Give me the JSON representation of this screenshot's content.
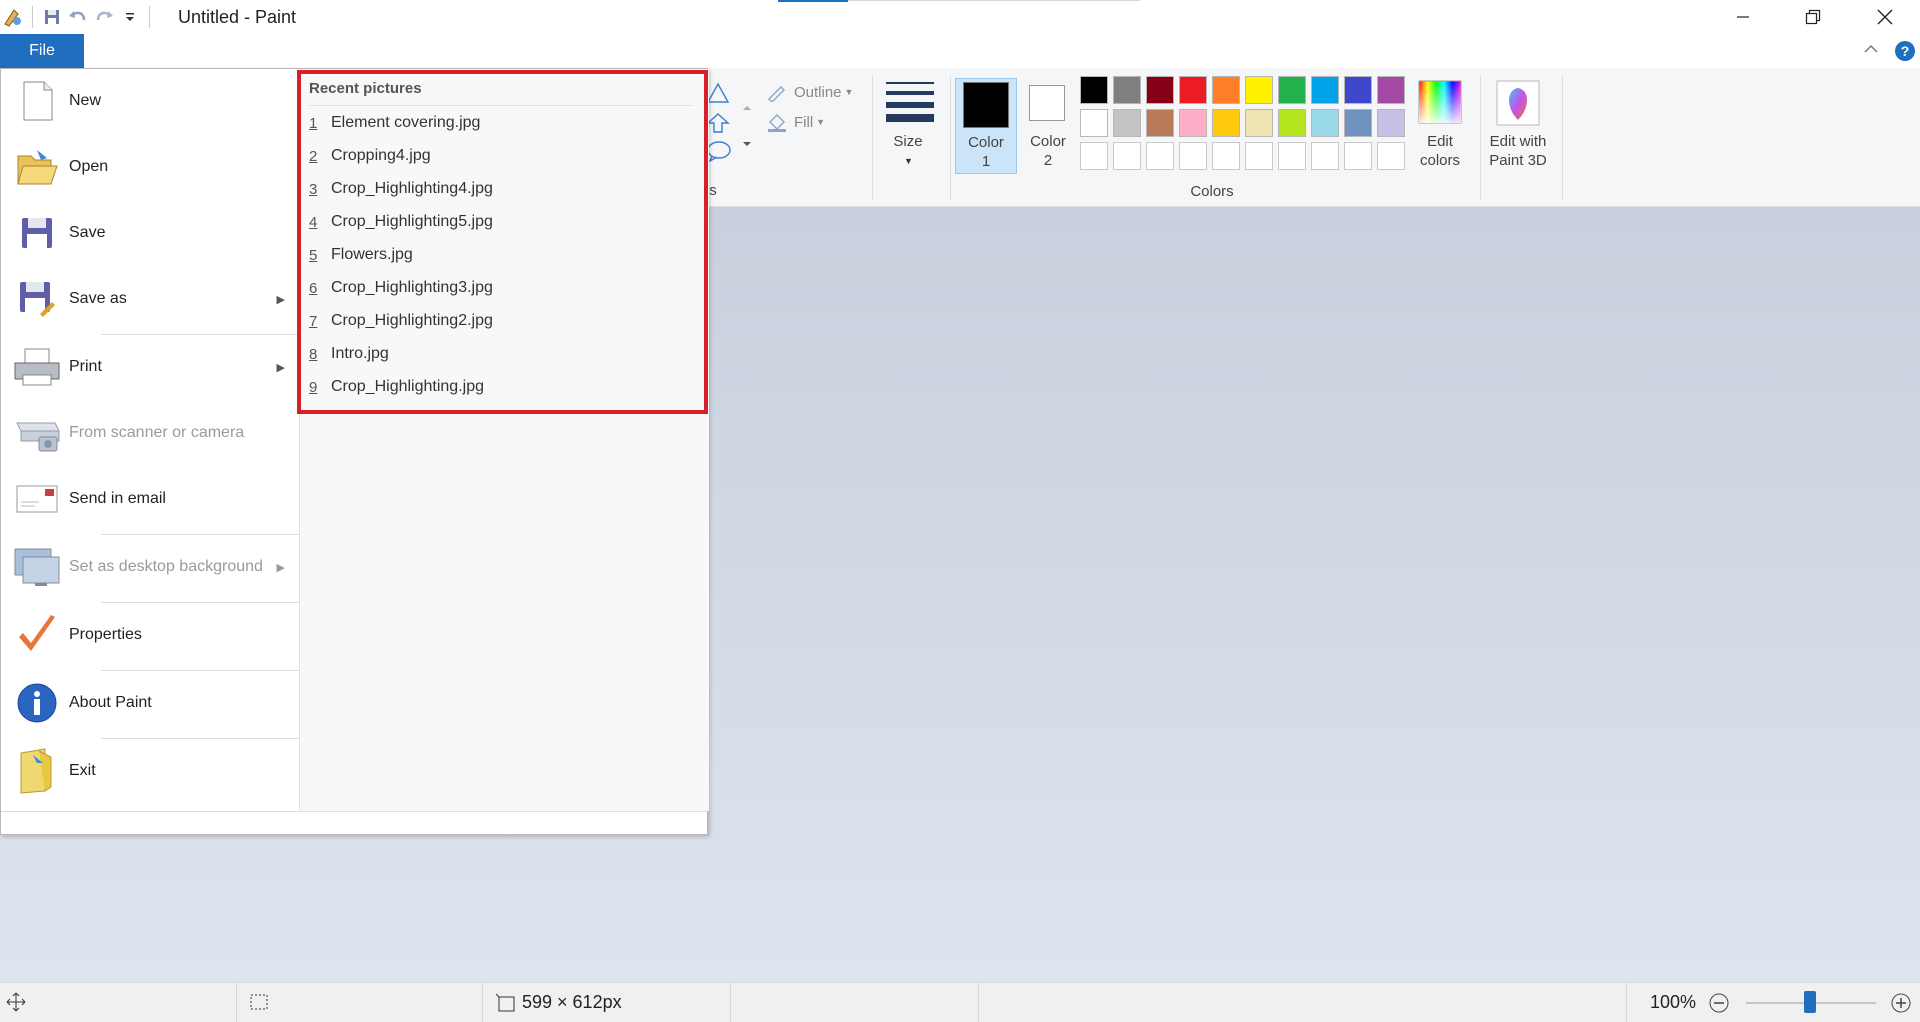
{
  "window": {
    "title": "Untitled - Paint"
  },
  "tabs": {
    "file_label": "File"
  },
  "ribbon": {
    "outline_label": "Outline",
    "fill_label": "Fill",
    "size_label": "Size",
    "color1_line1": "Color",
    "color1_line2": "1",
    "color2_line1": "Color",
    "color2_line2": "2",
    "edit_colors_line1": "Edit",
    "edit_colors_line2": "colors",
    "paint3d_line1": "Edit with",
    "paint3d_line2": "Paint 3D",
    "colors_group_label": "Colors",
    "shapes_group_fragment": "s",
    "palette_row1": [
      "#000000",
      "#7f7f7f",
      "#880015",
      "#ed1c24",
      "#ff7f27",
      "#fff200",
      "#22b14c",
      "#00a2e8",
      "#3f48cc",
      "#a349a4"
    ],
    "palette_row2": [
      "#ffffff",
      "#c3c3c3",
      "#b97a57",
      "#ffaec9",
      "#ffc90e",
      "#efe4b0",
      "#b5e61d",
      "#99d9ea",
      "#7092be",
      "#c8bfe7"
    ]
  },
  "file_menu": {
    "items": [
      {
        "label": "New",
        "icon": "new-document-icon"
      },
      {
        "label": "Open",
        "icon": "open-folder-icon"
      },
      {
        "label": "Save",
        "icon": "save-icon"
      },
      {
        "label": "Save as",
        "icon": "save-as-icon"
      },
      {
        "label": "Print",
        "icon": "printer-icon"
      },
      {
        "label": "From scanner or camera",
        "icon": "scanner-icon"
      },
      {
        "label": "Send in email",
        "icon": "email-icon"
      },
      {
        "label": "Set as desktop background",
        "icon": "desktop-icon"
      },
      {
        "label": "Properties",
        "icon": "checkmark-icon"
      },
      {
        "label": "About Paint",
        "icon": "info-icon"
      },
      {
        "label": "Exit",
        "icon": "exit-icon"
      }
    ],
    "recent_title": "Recent pictures",
    "recent": [
      {
        "num": "1",
        "name": "Element covering.jpg"
      },
      {
        "num": "2",
        "name": "Cropping4.jpg"
      },
      {
        "num": "3",
        "name": "Crop_Highlighting4.jpg"
      },
      {
        "num": "4",
        "name": "Crop_Highlighting5.jpg"
      },
      {
        "num": "5",
        "name": "Flowers.jpg"
      },
      {
        "num": "6",
        "name": "Crop_Highlighting3.jpg"
      },
      {
        "num": "7",
        "name": "Crop_Highlighting2.jpg"
      },
      {
        "num": "8",
        "name": "Intro.jpg"
      },
      {
        "num": "9",
        "name": "Crop_Highlighting.jpg"
      }
    ]
  },
  "status": {
    "canvas_size": "599 × 612px",
    "zoom": "100%"
  }
}
